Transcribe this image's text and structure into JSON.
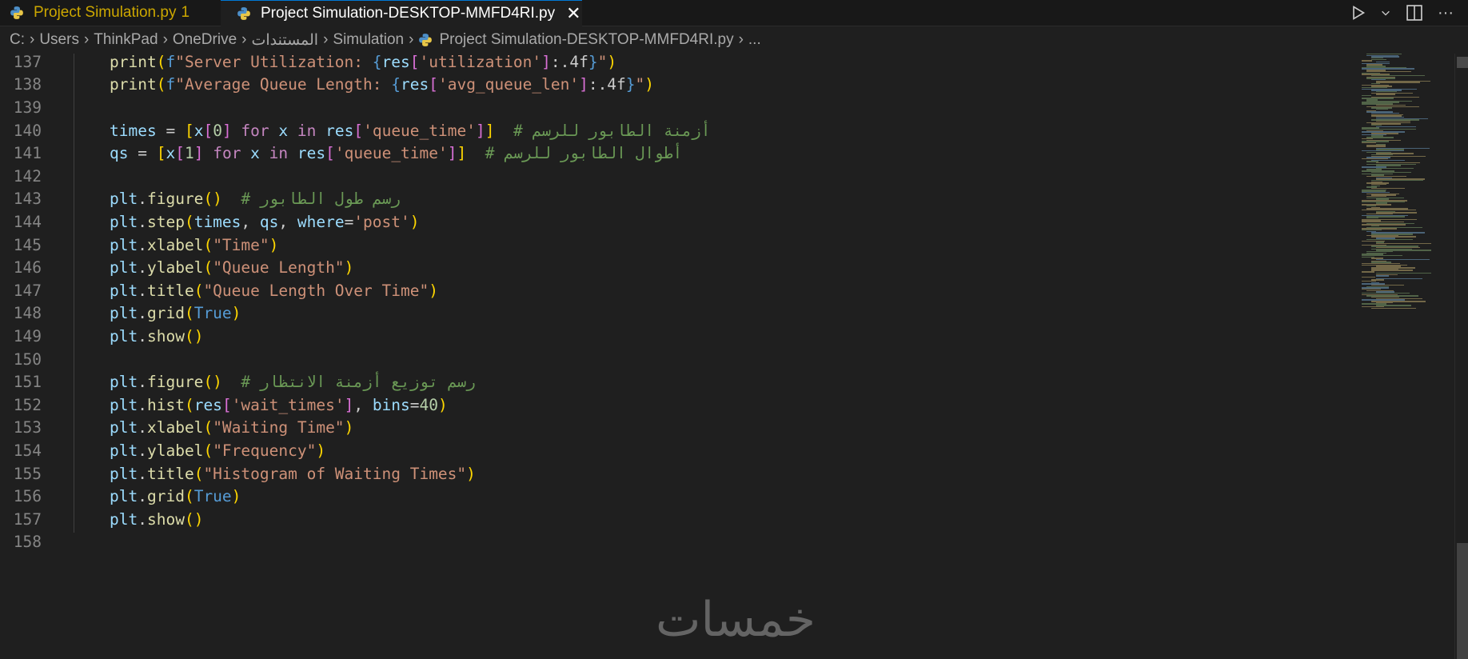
{
  "tabs": [
    {
      "label": "Project Simulation.py",
      "badge": "1",
      "color": "#cca700"
    },
    {
      "label": "Project Simulation-DESKTOP-MMFD4RI.py",
      "close": "✕"
    }
  ],
  "breadcrumb": [
    "C:",
    "Users",
    "ThinkPad",
    "OneDrive",
    "المستندات",
    "Simulation",
    "Project Simulation-DESKTOP-MMFD4RI.py",
    "..."
  ],
  "toolbar": {
    "run_icon": "play-icon",
    "more": "···"
  },
  "lines": [
    {
      "n": "137",
      "tokens": [
        [
          "tk-fn",
          "print"
        ],
        [
          "tk-p1",
          "("
        ],
        [
          "tk-const",
          "f"
        ],
        [
          "tk-str",
          "\"Server Utilization: "
        ],
        [
          "tk-const",
          "{"
        ],
        [
          "tk-var",
          "res"
        ],
        [
          "tk-p2",
          "["
        ],
        [
          "tk-str",
          "'utilization'"
        ],
        [
          "tk-p2",
          "]"
        ],
        [
          "tk-plain",
          ":.4f"
        ],
        [
          "tk-const",
          "}"
        ],
        [
          "tk-str",
          "\""
        ],
        [
          "tk-p1",
          ")"
        ]
      ]
    },
    {
      "n": "138",
      "tokens": [
        [
          "tk-fn",
          "print"
        ],
        [
          "tk-p1",
          "("
        ],
        [
          "tk-const",
          "f"
        ],
        [
          "tk-str",
          "\"Average Queue Length: "
        ],
        [
          "tk-const",
          "{"
        ],
        [
          "tk-var",
          "res"
        ],
        [
          "tk-p2",
          "["
        ],
        [
          "tk-str",
          "'avg_queue_len'"
        ],
        [
          "tk-p2",
          "]"
        ],
        [
          "tk-plain",
          ":.4f"
        ],
        [
          "tk-const",
          "}"
        ],
        [
          "tk-str",
          "\""
        ],
        [
          "tk-p1",
          ")"
        ]
      ]
    },
    {
      "n": "139",
      "tokens": []
    },
    {
      "n": "140",
      "tokens": [
        [
          "tk-var",
          "times"
        ],
        [
          "tk-plain",
          " = "
        ],
        [
          "tk-p1",
          "["
        ],
        [
          "tk-var",
          "x"
        ],
        [
          "tk-p2",
          "["
        ],
        [
          "tk-num",
          "0"
        ],
        [
          "tk-p2",
          "]"
        ],
        [
          "tk-kw",
          " for "
        ],
        [
          "tk-var",
          "x"
        ],
        [
          "tk-kw",
          " in "
        ],
        [
          "tk-var",
          "res"
        ],
        [
          "tk-p2",
          "["
        ],
        [
          "tk-str",
          "'queue_time'"
        ],
        [
          "tk-p2",
          "]"
        ],
        [
          "tk-p1",
          "]"
        ],
        [
          "tk-com",
          "  # أزمنة الطابور للرسم"
        ]
      ]
    },
    {
      "n": "141",
      "tokens": [
        [
          "tk-var",
          "qs"
        ],
        [
          "tk-plain",
          " = "
        ],
        [
          "tk-p1",
          "["
        ],
        [
          "tk-var",
          "x"
        ],
        [
          "tk-p2",
          "["
        ],
        [
          "tk-num",
          "1"
        ],
        [
          "tk-p2",
          "]"
        ],
        [
          "tk-kw",
          " for "
        ],
        [
          "tk-var",
          "x"
        ],
        [
          "tk-kw",
          " in "
        ],
        [
          "tk-var",
          "res"
        ],
        [
          "tk-p2",
          "["
        ],
        [
          "tk-str",
          "'queue_time'"
        ],
        [
          "tk-p2",
          "]"
        ],
        [
          "tk-p1",
          "]"
        ],
        [
          "tk-com",
          "  # أطوال الطابور للرسم"
        ]
      ]
    },
    {
      "n": "142",
      "tokens": []
    },
    {
      "n": "143",
      "tokens": [
        [
          "tk-var",
          "plt"
        ],
        [
          "tk-plain",
          "."
        ],
        [
          "tk-fn",
          "figure"
        ],
        [
          "tk-p1",
          "()"
        ],
        [
          "tk-com",
          "  # رسم طول الطابور"
        ]
      ]
    },
    {
      "n": "144",
      "tokens": [
        [
          "tk-var",
          "plt"
        ],
        [
          "tk-plain",
          "."
        ],
        [
          "tk-fn",
          "step"
        ],
        [
          "tk-p1",
          "("
        ],
        [
          "tk-var",
          "times"
        ],
        [
          "tk-plain",
          ", "
        ],
        [
          "tk-var",
          "qs"
        ],
        [
          "tk-plain",
          ", "
        ],
        [
          "tk-var",
          "where"
        ],
        [
          "tk-plain",
          "="
        ],
        [
          "tk-str",
          "'post'"
        ],
        [
          "tk-p1",
          ")"
        ]
      ]
    },
    {
      "n": "145",
      "tokens": [
        [
          "tk-var",
          "plt"
        ],
        [
          "tk-plain",
          "."
        ],
        [
          "tk-fn",
          "xlabel"
        ],
        [
          "tk-p1",
          "("
        ],
        [
          "tk-str",
          "\"Time\""
        ],
        [
          "tk-p1",
          ")"
        ]
      ]
    },
    {
      "n": "146",
      "tokens": [
        [
          "tk-var",
          "plt"
        ],
        [
          "tk-plain",
          "."
        ],
        [
          "tk-fn",
          "ylabel"
        ],
        [
          "tk-p1",
          "("
        ],
        [
          "tk-str",
          "\"Queue Length\""
        ],
        [
          "tk-p1",
          ")"
        ]
      ]
    },
    {
      "n": "147",
      "tokens": [
        [
          "tk-var",
          "plt"
        ],
        [
          "tk-plain",
          "."
        ],
        [
          "tk-fn",
          "title"
        ],
        [
          "tk-p1",
          "("
        ],
        [
          "tk-str",
          "\"Queue Length Over Time\""
        ],
        [
          "tk-p1",
          ")"
        ]
      ]
    },
    {
      "n": "148",
      "tokens": [
        [
          "tk-var",
          "plt"
        ],
        [
          "tk-plain",
          "."
        ],
        [
          "tk-fn",
          "grid"
        ],
        [
          "tk-p1",
          "("
        ],
        [
          "tk-const",
          "True"
        ],
        [
          "tk-p1",
          ")"
        ]
      ]
    },
    {
      "n": "149",
      "tokens": [
        [
          "tk-var",
          "plt"
        ],
        [
          "tk-plain",
          "."
        ],
        [
          "tk-fn",
          "show"
        ],
        [
          "tk-p1",
          "()"
        ]
      ]
    },
    {
      "n": "150",
      "tokens": []
    },
    {
      "n": "151",
      "tokens": [
        [
          "tk-var",
          "plt"
        ],
        [
          "tk-plain",
          "."
        ],
        [
          "tk-fn",
          "figure"
        ],
        [
          "tk-p1",
          "()"
        ],
        [
          "tk-com",
          "  # رسم توزيع أزمنة الانتظار"
        ]
      ]
    },
    {
      "n": "152",
      "tokens": [
        [
          "tk-var",
          "plt"
        ],
        [
          "tk-plain",
          "."
        ],
        [
          "tk-fn",
          "hist"
        ],
        [
          "tk-p1",
          "("
        ],
        [
          "tk-var",
          "res"
        ],
        [
          "tk-p2",
          "["
        ],
        [
          "tk-str",
          "'wait_times'"
        ],
        [
          "tk-p2",
          "]"
        ],
        [
          "tk-plain",
          ", "
        ],
        [
          "tk-var",
          "bins"
        ],
        [
          "tk-plain",
          "="
        ],
        [
          "tk-num",
          "40"
        ],
        [
          "tk-p1",
          ")"
        ]
      ]
    },
    {
      "n": "153",
      "tokens": [
        [
          "tk-var",
          "plt"
        ],
        [
          "tk-plain",
          "."
        ],
        [
          "tk-fn",
          "xlabel"
        ],
        [
          "tk-p1",
          "("
        ],
        [
          "tk-str",
          "\"Waiting Time\""
        ],
        [
          "tk-p1",
          ")"
        ]
      ]
    },
    {
      "n": "154",
      "tokens": [
        [
          "tk-var",
          "plt"
        ],
        [
          "tk-plain",
          "."
        ],
        [
          "tk-fn",
          "ylabel"
        ],
        [
          "tk-p1",
          "("
        ],
        [
          "tk-str",
          "\"Frequency\""
        ],
        [
          "tk-p1",
          ")"
        ]
      ]
    },
    {
      "n": "155",
      "tokens": [
        [
          "tk-var",
          "plt"
        ],
        [
          "tk-plain",
          "."
        ],
        [
          "tk-fn",
          "title"
        ],
        [
          "tk-p1",
          "("
        ],
        [
          "tk-str",
          "\"Histogram of Waiting Times\""
        ],
        [
          "tk-p1",
          ")"
        ]
      ]
    },
    {
      "n": "156",
      "tokens": [
        [
          "tk-var",
          "plt"
        ],
        [
          "tk-plain",
          "."
        ],
        [
          "tk-fn",
          "grid"
        ],
        [
          "tk-p1",
          "("
        ],
        [
          "tk-const",
          "True"
        ],
        [
          "tk-p1",
          ")"
        ]
      ]
    },
    {
      "n": "157",
      "tokens": [
        [
          "tk-var",
          "plt"
        ],
        [
          "tk-plain",
          "."
        ],
        [
          "tk-fn",
          "show"
        ],
        [
          "tk-p1",
          "()"
        ]
      ]
    },
    {
      "n": "158",
      "tokens": []
    }
  ],
  "watermark": "خمسات"
}
